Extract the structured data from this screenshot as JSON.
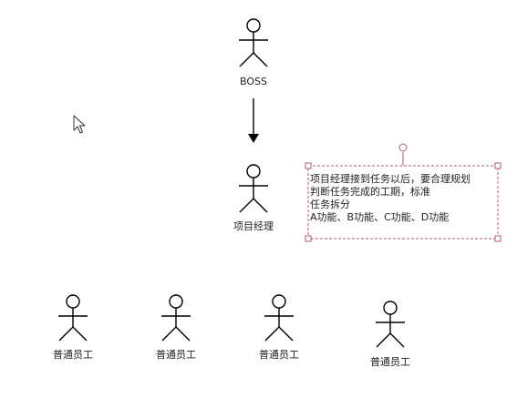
{
  "diagram": {
    "actors": {
      "boss": {
        "label": "BOSS"
      },
      "manager": {
        "label": "项目经理"
      },
      "employee_1": {
        "label": "普通员工"
      },
      "employee_2": {
        "label": "普通员工"
      },
      "employee_3": {
        "label": "普通员工"
      },
      "employee_4": {
        "label": "普通员工"
      }
    },
    "note": {
      "lines": [
        "项目经理接到任务以后，要合理规划",
        "判断任务完成的工期，标准",
        "任务拆分",
        "A功能、B功能、C功能、D功能"
      ],
      "border_color": "#b05a6a"
    },
    "arrow_color": "#000000",
    "icons": [
      "cursor-icon"
    ]
  }
}
